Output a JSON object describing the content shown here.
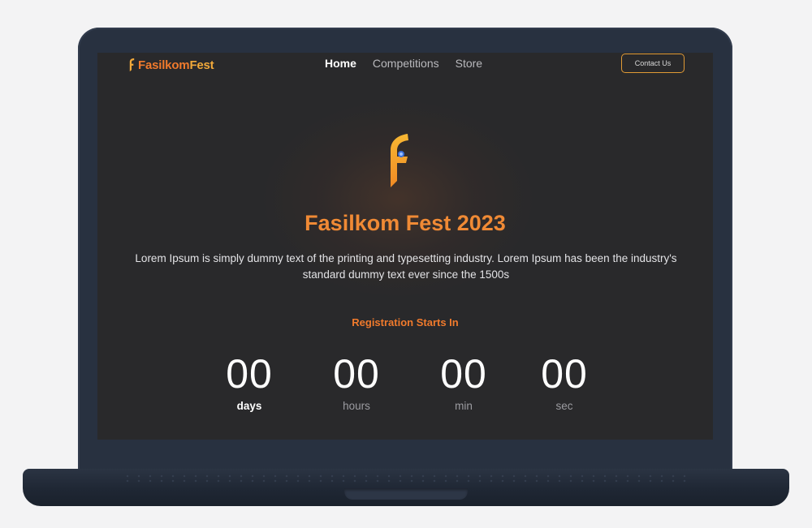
{
  "nav": {
    "logo_part1": "Fasilkom",
    "logo_part2": "Fest",
    "links": [
      {
        "label": "Home",
        "active": true
      },
      {
        "label": "Competitions",
        "active": false
      },
      {
        "label": "Store",
        "active": false
      }
    ],
    "contact_label": "Contact Us"
  },
  "hero": {
    "logo_icon": "fasilkom-fest-f-logo",
    "title": "Fasilkom Fest 2023",
    "description": "Lorem Ipsum is simply dummy text of the printing and typesetting industry. Lorem Ipsum has been the industry's standard dummy text ever since the 1500s"
  },
  "countdown": {
    "label": "Registration Starts In",
    "units": [
      {
        "value": "00",
        "label": "days"
      },
      {
        "value": "00",
        "label": "hours"
      },
      {
        "value": "00",
        "label": "min"
      },
      {
        "value": "00",
        "label": "sec"
      }
    ]
  },
  "colors": {
    "accent_orange": "#f07a2c",
    "accent_gold": "#f1a93a",
    "screen_bg": "#29292b",
    "laptop_frame": "#283140",
    "page_bg": "#f3f3f4"
  }
}
